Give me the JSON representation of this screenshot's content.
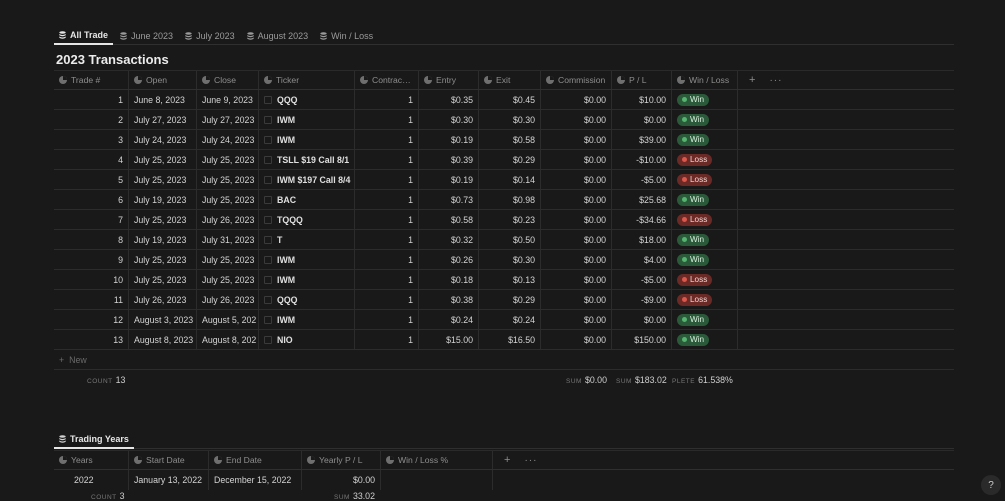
{
  "tabs": [
    "All Trade",
    "June 2023",
    "July 2023",
    "August 2023",
    "Win / Loss"
  ],
  "page_title": "2023 Transactions",
  "columns": [
    "Trade #",
    "Open",
    "Close",
    "Ticker",
    "Contrac…",
    "Entry",
    "Exit",
    "Commission",
    "P / L",
    "Win / Loss"
  ],
  "rows": [
    {
      "trade": "1",
      "open": "June 8, 2023",
      "close": "June 9, 2023",
      "ticker": "QQQ",
      "contracts": "1",
      "entry": "$0.35",
      "exit": "$0.45",
      "commission": "$0.00",
      "pl": "$10.00",
      "wl": "Win"
    },
    {
      "trade": "2",
      "open": "July 27, 2023",
      "close": "July 27, 2023",
      "ticker": "IWM",
      "contracts": "1",
      "entry": "$0.30",
      "exit": "$0.30",
      "commission": "$0.00",
      "pl": "$0.00",
      "wl": "Win"
    },
    {
      "trade": "3",
      "open": "July 24, 2023",
      "close": "July 24, 2023",
      "ticker": "IWM",
      "contracts": "1",
      "entry": "$0.19",
      "exit": "$0.58",
      "commission": "$0.00",
      "pl": "$39.00",
      "wl": "Win"
    },
    {
      "trade": "4",
      "open": "July 25, 2023",
      "close": "July 25, 2023",
      "ticker": "TSLL $19 Call 8/1",
      "contracts": "1",
      "entry": "$0.39",
      "exit": "$0.29",
      "commission": "$0.00",
      "pl": "-$10.00",
      "wl": "Loss"
    },
    {
      "trade": "5",
      "open": "July 25, 2023",
      "close": "July 25, 2023",
      "ticker": "IWM $197 Call 8/4",
      "contracts": "1",
      "entry": "$0.19",
      "exit": "$0.14",
      "commission": "$0.00",
      "pl": "-$5.00",
      "wl": "Loss"
    },
    {
      "trade": "6",
      "open": "July 19, 2023",
      "close": "July 25, 2023",
      "ticker": "BAC",
      "contracts": "1",
      "entry": "$0.73",
      "exit": "$0.98",
      "commission": "$0.00",
      "pl": "$25.68",
      "wl": "Win"
    },
    {
      "trade": "7",
      "open": "July 25, 2023",
      "close": "July 26, 2023",
      "ticker": "TQQQ",
      "contracts": "1",
      "entry": "$0.58",
      "exit": "$0.23",
      "commission": "$0.00",
      "pl": "-$34.66",
      "wl": "Loss"
    },
    {
      "trade": "8",
      "open": "July 19, 2023",
      "close": "July 31, 2023",
      "ticker": "T",
      "contracts": "1",
      "entry": "$0.32",
      "exit": "$0.50",
      "commission": "$0.00",
      "pl": "$18.00",
      "wl": "Win"
    },
    {
      "trade": "9",
      "open": "July 25, 2023",
      "close": "July 25, 2023",
      "ticker": "IWM",
      "contracts": "1",
      "entry": "$0.26",
      "exit": "$0.30",
      "commission": "$0.00",
      "pl": "$4.00",
      "wl": "Win"
    },
    {
      "trade": "10",
      "open": "July 25, 2023",
      "close": "July 25, 2023",
      "ticker": "IWM",
      "contracts": "1",
      "entry": "$0.18",
      "exit": "$0.13",
      "commission": "$0.00",
      "pl": "-$5.00",
      "wl": "Loss"
    },
    {
      "trade": "11",
      "open": "July 26, 2023",
      "close": "July 26, 2023",
      "ticker": "QQQ",
      "contracts": "1",
      "entry": "$0.38",
      "exit": "$0.29",
      "commission": "$0.00",
      "pl": "-$9.00",
      "wl": "Loss"
    },
    {
      "trade": "12",
      "open": "August 3, 2023",
      "close": "August 5, 202",
      "ticker": "IWM",
      "contracts": "1",
      "entry": "$0.24",
      "exit": "$0.24",
      "commission": "$0.00",
      "pl": "$0.00",
      "wl": "Win"
    },
    {
      "trade": "13",
      "open": "August 8, 2023",
      "close": "August 8, 202",
      "ticker": "NIO",
      "contracts": "1",
      "entry": "$15.00",
      "exit": "$16.50",
      "commission": "$0.00",
      "pl": "$150.00",
      "wl": "Win"
    }
  ],
  "new_label": "New",
  "footer": {
    "count_label": "COUNT",
    "count_value": "13",
    "sum_label": "SUM",
    "commission_sum": "$0.00",
    "pl_sum": "$183.02",
    "complete_label": "PLETE",
    "complete_value": "61.538%"
  },
  "db2": {
    "tab": "Trading Years",
    "columns": [
      "Years",
      "Start Date",
      "End Date",
      "Yearly P / L",
      "Win / Loss %"
    ],
    "rows": [
      {
        "years": "2022",
        "start": "January 13, 2022",
        "end": "December 15, 2022",
        "pl": "$0.00",
        "wlp": ""
      }
    ],
    "count_label": "COUNT",
    "count_value": "3",
    "sum_label": "SUM",
    "sum_value": "33.02"
  },
  "help": "?",
  "colors": {
    "background": "#191919",
    "win": "#2b5a3a",
    "loss": "#6b2a26"
  }
}
